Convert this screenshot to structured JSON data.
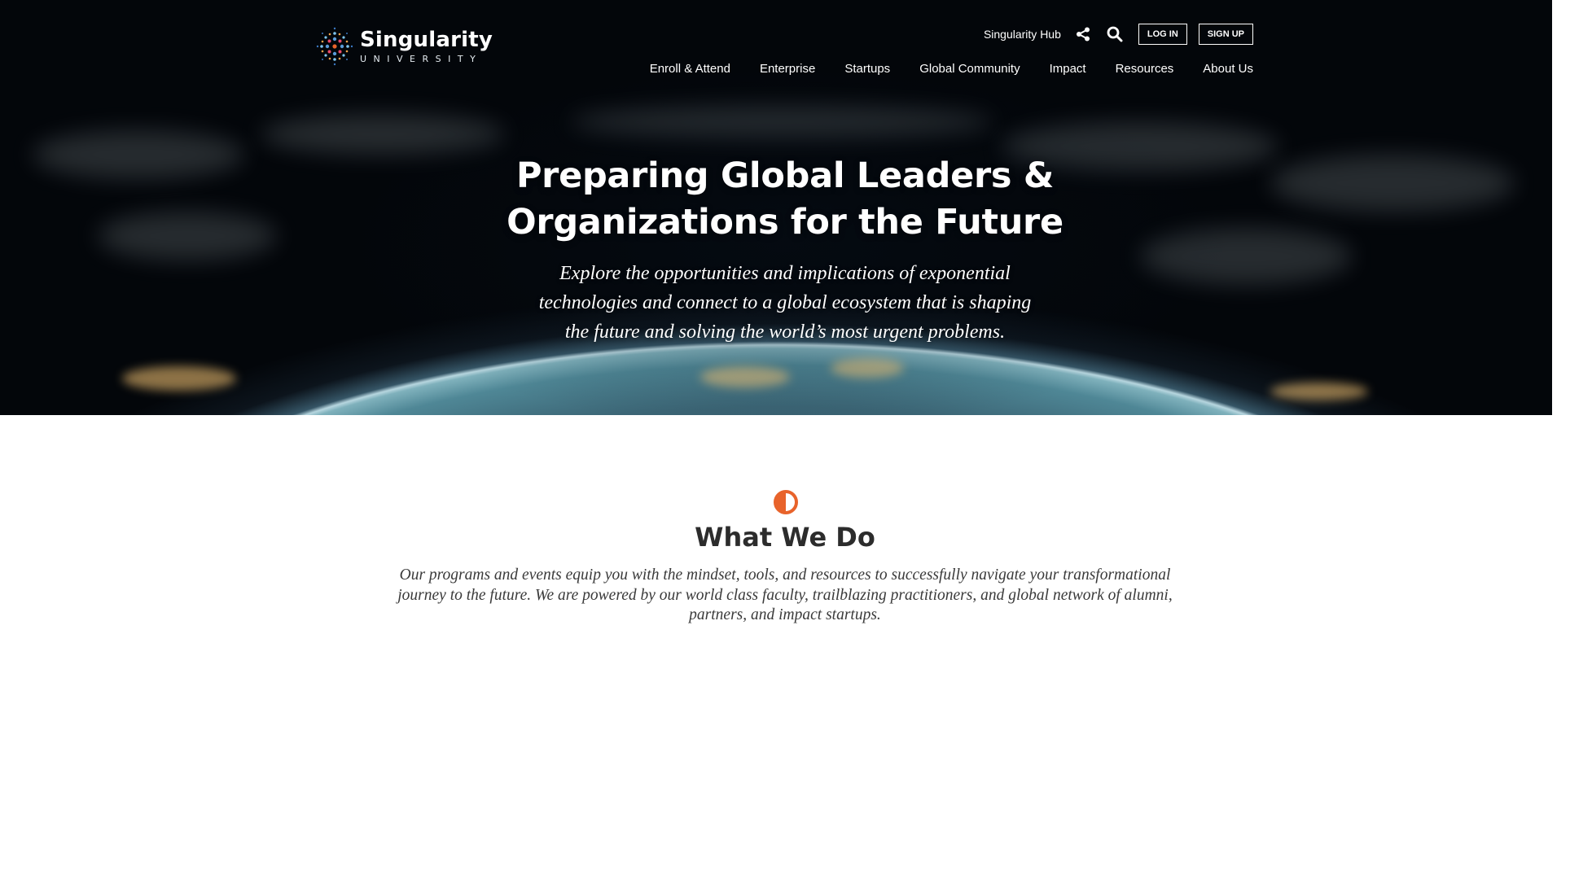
{
  "brand": {
    "name": "Singularity",
    "subtitle": "UNIVERSITY"
  },
  "utility": {
    "hub_link": "Singularity Hub",
    "share_icon": "share-icon",
    "search_icon": "search-icon",
    "login_label": "LOG IN",
    "signup_label": "SIGN UP"
  },
  "nav": {
    "items": [
      {
        "label": "Enroll & Attend"
      },
      {
        "label": "Enterprise"
      },
      {
        "label": "Startups"
      },
      {
        "label": "Global Community"
      },
      {
        "label": "Impact"
      },
      {
        "label": "Resources"
      },
      {
        "label": "About Us"
      }
    ]
  },
  "hero": {
    "title_lines": [
      "Preparing Global Leaders &",
      "Organizations for the Future"
    ],
    "subtitle_lines": [
      "Explore the opportunities and implications of exponential",
      "technologies and connect to a global ecosystem that is shaping",
      "the future and solving the world’s most urgent problems."
    ]
  },
  "what_we_do": {
    "icon": "half-circle-icon",
    "title": "What We Do",
    "text_lines": [
      "Our programs and events equip you with the mindset, tools, and resources to successfully navigate your transformational",
      "journey to the future. We are powered by our world class faculty, trailblazing practitioners, and global network of alumni,",
      "partners, and impact startups."
    ]
  },
  "colors": {
    "accent": "#e8632b",
    "hero_text": "#ffffff",
    "heading": "#2c2c2c",
    "body_text": "#3a3a3a"
  }
}
